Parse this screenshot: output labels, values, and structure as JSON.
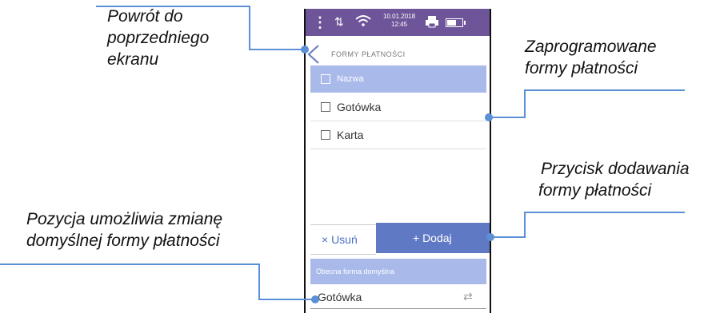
{
  "callouts": {
    "back": [
      "Powrót do",
      "poprzedniego",
      "ekranu"
    ],
    "programmed": [
      "Zaprogramowane",
      "formy płatności"
    ],
    "add_button": [
      "Przycisk dodawania",
      "formy płatności"
    ],
    "default_position": [
      "Pozycja umożliwia zmianę",
      "domyślnej formy płatności"
    ]
  },
  "status_bar": {
    "date": "10.01.2018",
    "time": "12:45",
    "background_color": "#6e5599"
  },
  "header": {
    "title": "FORMY PŁATNOŚCI",
    "back_icon": "chevron-left-icon"
  },
  "list": {
    "column_header": "Nazwa",
    "items": [
      {
        "label": "Gotówka"
      },
      {
        "label": "Karta"
      }
    ]
  },
  "actions": {
    "delete_label": "× Usuń",
    "add_label": "+ Dodaj",
    "accent_color": "#5f79c4"
  },
  "default_form": {
    "header": "Obecna forma domyślna",
    "value": "Gotówka",
    "switch_icon": "swap-arrows-icon"
  },
  "colors": {
    "leader_lines": "#5b8fd6",
    "row_header": "#a9b9ea"
  }
}
